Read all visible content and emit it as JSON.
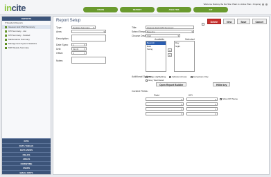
{
  "header": {
    "logo_text": "in",
    "logo_accent": "cite",
    "tabs": [
      "VISION",
      "REPORT",
      "ANALYSIS",
      "KIT"
    ],
    "user_text": "Welcome Rodney Ibe Rel Site: Plant A • Active Plan • Ongoing"
  },
  "sidebar": {
    "heading": "REPORTS",
    "subheading": "Standard Reports",
    "items": [
      "Gleason End OVR Summary",
      "KPI Summary - List",
      "KPI Summary - Scatted",
      "Maintenance Summary",
      "Management System Statistics",
      "MRI Weekly Summary"
    ],
    "bottom_buttons": [
      "KPIS",
      "DATA TABLES",
      "DATA VIEWS",
      "FIELDS",
      "AREAS",
      "DOWNTIME",
      "USERS",
      "EMAIL DISTS"
    ]
  },
  "panel": {
    "title": "Report Setup",
    "toolbar": [
      "Delete",
      "New",
      "Save",
      "Cancel"
    ],
    "left_labels": {
      "type": "Type:",
      "area": "Area:",
      "description": "Description:",
      "date_span": "Date Span:",
      "unit": "Unit:",
      "offset": "Offset:",
      "notes": "Notes:"
    },
    "left_values": {
      "type": "Detailed Summary",
      "date_span": "1",
      "unit": "Month",
      "offset": "0"
    },
    "right_labels": {
      "title": "Title:",
      "select_template": "Select Template:",
      "choose_detail": "Choose Detail Field:",
      "available": "Available",
      "selected": "Selected",
      "additional_options": "Additional Options:",
      "content_fields": "Content Fields:",
      "field": "Field",
      "kpi": "KPI"
    },
    "right_values": {
      "title": "Gleason End OVR Summary",
      "template": "Baseline",
      "detail_field": "Shift"
    },
    "available_items": [
      "Bearcsh",
      "Both",
      "Swing"
    ],
    "selected_items": [
      "Day",
      "Night"
    ],
    "options": [
      "Range Highlighting",
      "Indicator Arrows",
      "Exceptions Only",
      "Grey Total Detail"
    ],
    "open_report_builder": "Open Report Builder",
    "hilite_key": "Hilite key",
    "show_kpi_name": "Show KPI Name"
  }
}
